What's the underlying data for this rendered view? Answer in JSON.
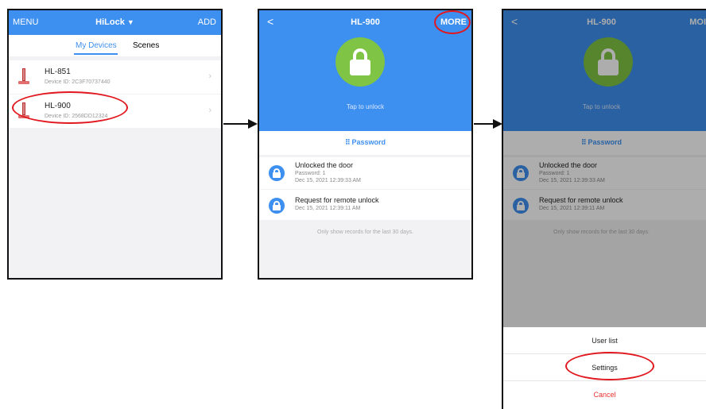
{
  "screen1": {
    "menu": "MENU",
    "title": "HiLock",
    "title_caret": "▼",
    "add": "ADD",
    "tabs": [
      {
        "label": "My Devices"
      },
      {
        "label": "Scenes"
      }
    ],
    "devices": [
      {
        "name": "HL-851",
        "id": "Device ID: 2C3F70737440"
      },
      {
        "name": "HL-900",
        "id": "Device ID: 2568DD12324"
      }
    ],
    "chevron": "›"
  },
  "screen2": {
    "back": "<",
    "title": "HL-900",
    "more": "MORE",
    "tap_to_unlock": "Tap to unlock",
    "password_label": "Password",
    "records": [
      {
        "title": "Unlocked the door",
        "line1": "Password: 1",
        "line2": "Dec 15, 2021 12:39:33 AM"
      },
      {
        "title": "Request for remote unlock",
        "line1": "Dec 15, 2021 12:39:11 AM"
      }
    ],
    "note": "Only show records for the last 30 days."
  },
  "screen3": {
    "back": "<",
    "title": "HL-900",
    "more": "MOI",
    "tap_to_unlock": "Tap to unlock",
    "password_label": "Password",
    "records": [
      {
        "title": "Unlocked the door",
        "line1": "Password: 1",
        "line2": "Dec 15, 2021 12:39:33 AM"
      },
      {
        "title": "Request for remote unlock",
        "line1": "Dec 15, 2021 12:39:11 AM"
      }
    ],
    "note": "Only show records for the last 30 days.",
    "sheet": {
      "user_list": "User list",
      "settings": "Settings",
      "cancel": "Cancel"
    }
  },
  "colors": {
    "accent": "#3d8ff0",
    "lock_green": "#7fc444",
    "annotation": "#e1181f",
    "cancel": "#e8312f"
  }
}
